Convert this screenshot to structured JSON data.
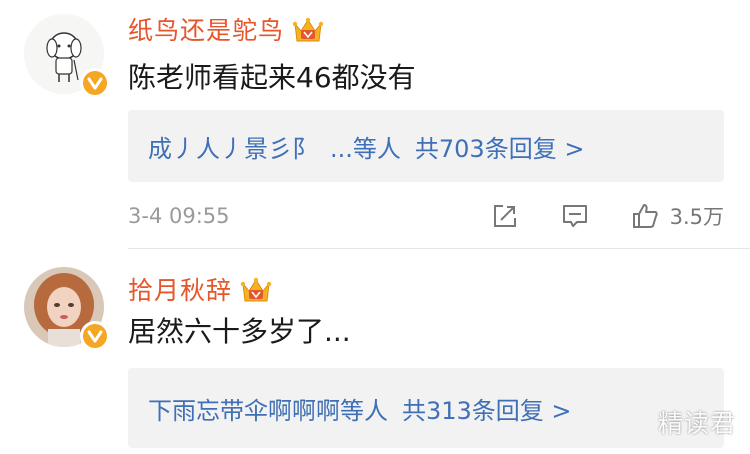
{
  "comments": [
    {
      "username": "纸鸟还是鸵鸟",
      "text": "陈老师看起来46都没有",
      "replies": {
        "names": "成丿人丿景彡阝",
        "ellipsis": "...等人",
        "count": "共703条回复 >"
      },
      "time": "3-4 09:55",
      "likes": "3.5万"
    },
    {
      "username": "拾月秋辞",
      "text": "居然六十多岁了...",
      "replies": {
        "names": "下雨忘带伞啊啊啊等人",
        "count": "共313条回复 >"
      }
    }
  ],
  "icons": {
    "verified": "verified-v-icon",
    "crown": "vip-crown-icon",
    "share": "share-icon",
    "comment": "comment-icon",
    "like": "like-thumb-icon"
  },
  "colors": {
    "username": "#e5562b",
    "reply_link": "#3f6fb6",
    "reply_bg": "#f2f2f2",
    "badge": "#f5a623",
    "meta": "#9a9a9a"
  },
  "watermark": "精读君"
}
